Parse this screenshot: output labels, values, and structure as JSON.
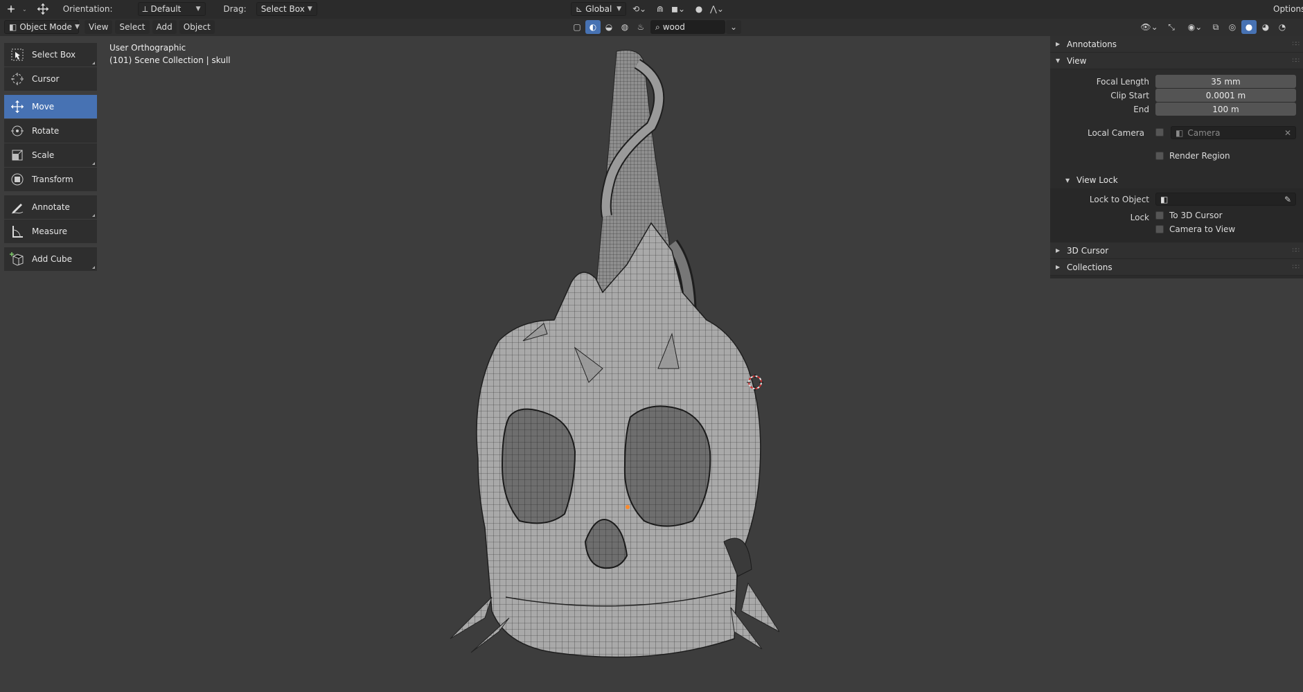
{
  "header": {
    "orientation_label": "Orientation:",
    "orientation_value": "Default",
    "drag_label": "Drag:",
    "drag_value": "Select Box",
    "transform_orientation": "Global",
    "options_label": "Options"
  },
  "header2": {
    "mode": "Object Mode",
    "menus": [
      "View",
      "Select",
      "Add",
      "Object"
    ],
    "search_value": "wood"
  },
  "toolbar": {
    "tools": [
      {
        "label": "Select Box",
        "icon": "select-box-icon"
      },
      {
        "label": "Cursor",
        "icon": "cursor-icon"
      },
      {
        "label": "Move",
        "icon": "move-icon",
        "active": true
      },
      {
        "label": "Rotate",
        "icon": "rotate-icon"
      },
      {
        "label": "Scale",
        "icon": "scale-icon"
      },
      {
        "label": "Transform",
        "icon": "transform-icon"
      },
      {
        "label": "Annotate",
        "icon": "annotate-icon"
      },
      {
        "label": "Measure",
        "icon": "measure-icon"
      },
      {
        "label": "Add Cube",
        "icon": "add-cube-icon"
      }
    ]
  },
  "viewport": {
    "view_name": "User Orthographic",
    "collection_info": "(101) Scene Collection | skull"
  },
  "npanel": {
    "annotations_label": "Annotations",
    "view_label": "View",
    "focal_length_label": "Focal Length",
    "focal_length_value": "35 mm",
    "clip_start_label": "Clip Start",
    "clip_start_value": "0.0001 m",
    "clip_end_label": "End",
    "clip_end_value": "100 m",
    "local_camera_label": "Local Camera",
    "local_camera_placeholder": "Camera",
    "render_region_label": "Render Region",
    "view_lock_label": "View Lock",
    "lock_to_object_label": "Lock to Object",
    "lock_label": "Lock",
    "to_3d_cursor_label": "To 3D Cursor",
    "camera_to_view_label": "Camera to View",
    "cursor_3d_label": "3D Cursor",
    "collections_label": "Collections"
  },
  "colors": {
    "viewport_bg": "#3d3d3d",
    "active_blue": "#4772b3",
    "panel_bg": "#2b2b2b",
    "mesh_fill": "#a8a8a8"
  }
}
